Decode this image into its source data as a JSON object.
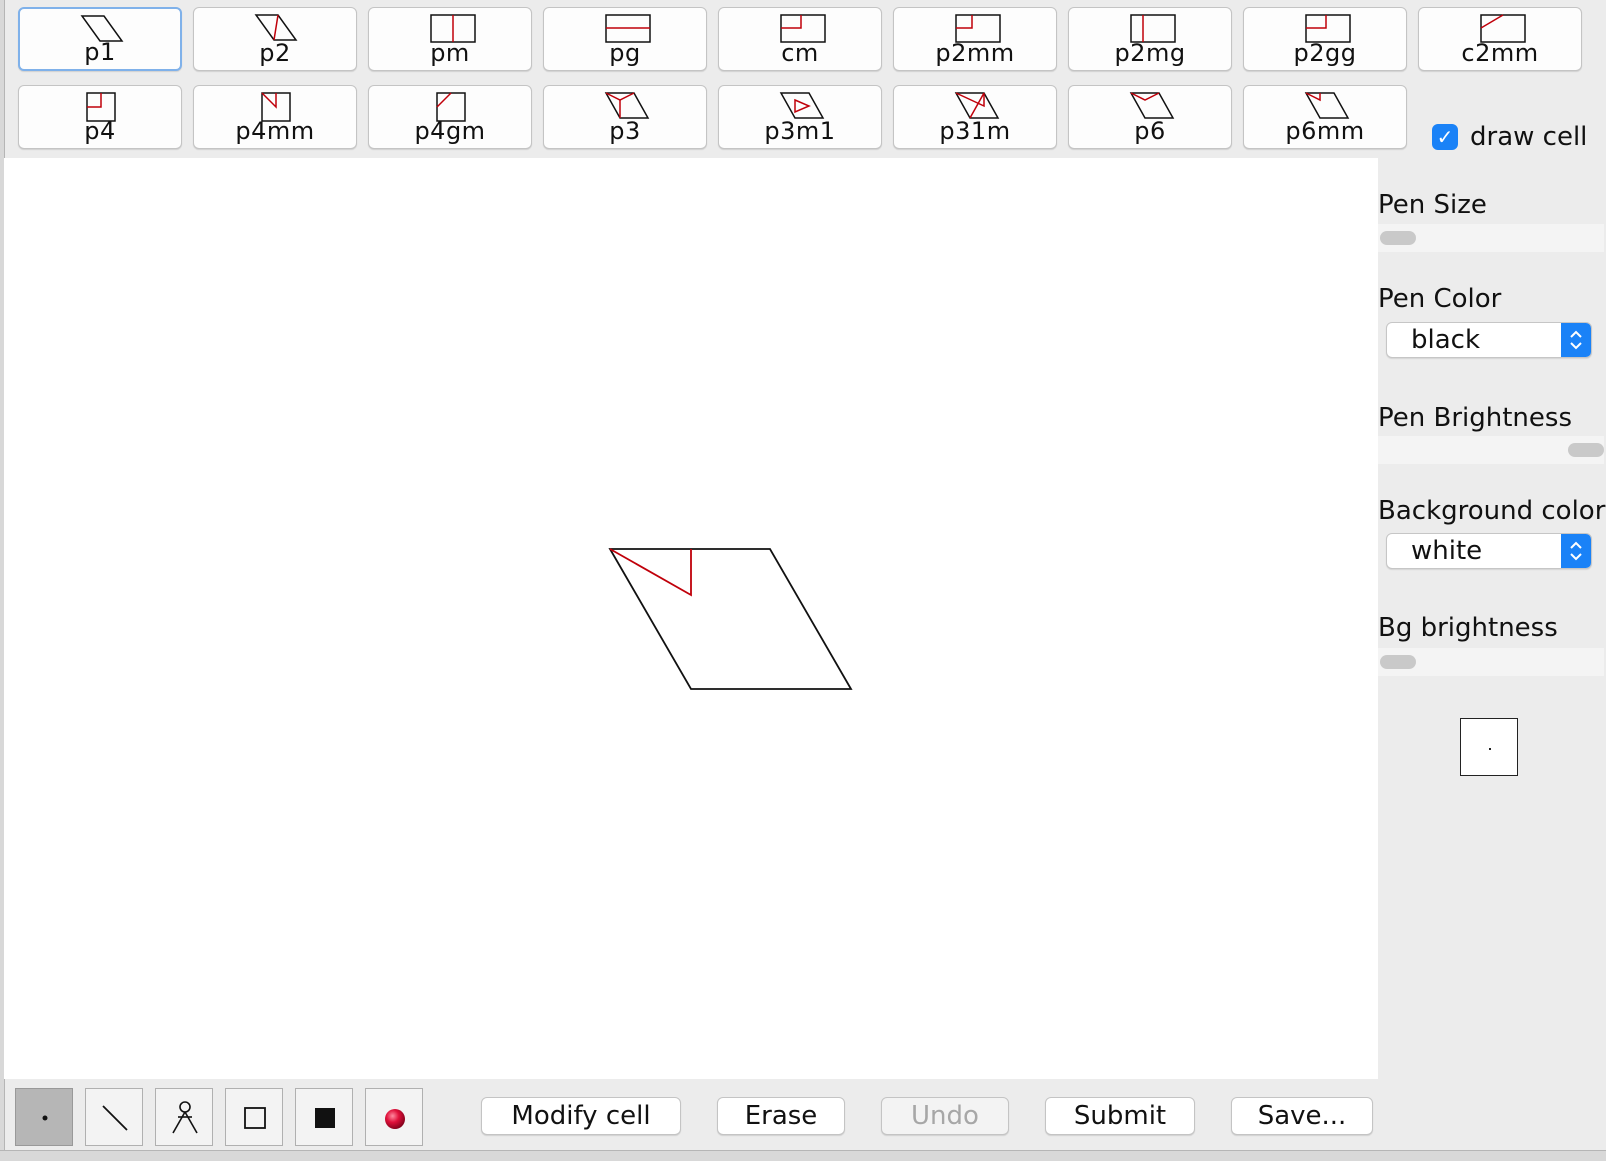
{
  "groups": [
    {
      "label": "p1",
      "icon": "p1-cell-icon",
      "selected": true
    },
    {
      "label": "p2",
      "icon": "p2-cell-icon"
    },
    {
      "label": "pm",
      "icon": "pm-cell-icon"
    },
    {
      "label": "pg",
      "icon": "pg-cell-icon"
    },
    {
      "label": "cm",
      "icon": "cm-cell-icon"
    },
    {
      "label": "p2mm",
      "icon": "p2mm-cell-icon"
    },
    {
      "label": "p2mg",
      "icon": "p2mg-cell-icon"
    },
    {
      "label": "p2gg",
      "icon": "p2gg-cell-icon"
    },
    {
      "label": "c2mm",
      "icon": "c2mm-cell-icon"
    },
    {
      "label": "p4",
      "icon": "p4-cell-icon"
    },
    {
      "label": "p4mm",
      "icon": "p4mm-cell-icon"
    },
    {
      "label": "p4gm",
      "icon": "p4gm-cell-icon"
    },
    {
      "label": "p3",
      "icon": "p3-cell-icon"
    },
    {
      "label": "p3m1",
      "icon": "p3m1-cell-icon"
    },
    {
      "label": "p31m",
      "icon": "p31m-cell-icon"
    },
    {
      "label": "p6",
      "icon": "p6-cell-icon"
    },
    {
      "label": "p6mm",
      "icon": "p6mm-cell-icon"
    }
  ],
  "draw_cell": {
    "label": "draw cell",
    "checked": true
  },
  "side_panel": {
    "pen_size_label": "Pen Size",
    "pen_size_value": 0,
    "pen_color_label": "Pen Color",
    "pen_color_value": "black",
    "pen_brightness_label": "Pen Brightness",
    "pen_brightness_value": 1,
    "background_color_label": "Background color",
    "background_color_value": "white",
    "bg_brightness_label": "Bg brightness",
    "bg_brightness_value": 0
  },
  "tools": [
    {
      "name": "dot-tool",
      "icon": "dot-icon",
      "selected": true
    },
    {
      "name": "line-tool",
      "icon": "line-icon"
    },
    {
      "name": "figure-tool",
      "icon": "figure-icon"
    },
    {
      "name": "rectangle-tool",
      "icon": "square-outline-icon"
    },
    {
      "name": "filled-rectangle-tool",
      "icon": "square-filled-icon"
    },
    {
      "name": "sphere-tool",
      "icon": "red-ball-icon"
    }
  ],
  "actions": {
    "modify_cell": "Modify cell",
    "erase": "Erase",
    "undo": "Undo",
    "submit": "Submit",
    "save": "Save..."
  },
  "colors": {
    "accent": "#1a82f7",
    "cell_mark": "#c0000a",
    "selected_border": "#7fb1ea"
  }
}
